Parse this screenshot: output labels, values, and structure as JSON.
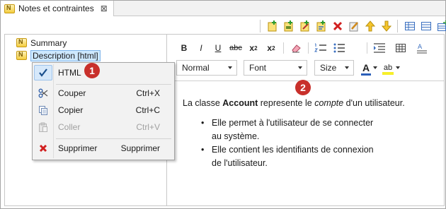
{
  "tab": {
    "title": "Notes et contraintes",
    "close": "⊠"
  },
  "tree": {
    "items": [
      {
        "label": "Summary",
        "selected": false
      },
      {
        "label": "Description [html]",
        "selected": true
      }
    ]
  },
  "context_menu": {
    "items": [
      {
        "label": "HTML",
        "shortcut": "",
        "checked": true,
        "enabled": true,
        "icon": "checkmark-icon"
      },
      {
        "label": "Couper",
        "shortcut": "Ctrl+X",
        "enabled": true,
        "icon": "scissors-icon"
      },
      {
        "label": "Copier",
        "shortcut": "Ctrl+C",
        "enabled": true,
        "icon": "copy-icon"
      },
      {
        "label": "Coller",
        "shortcut": "Ctrl+V",
        "enabled": false,
        "icon": "paste-icon"
      },
      {
        "label": "Supprimer",
        "shortcut": "Supprimer",
        "enabled": true,
        "icon": "delete-x-icon"
      }
    ]
  },
  "badges": {
    "one": "1",
    "two": "2"
  },
  "formatting": {
    "bold": "B",
    "italic": "I",
    "underline": "U",
    "strike": "abc",
    "subscript": "x",
    "subscript_mark": "2",
    "superscript": "x",
    "superscript_mark": "2"
  },
  "selects": {
    "style": "Normal",
    "font": "Font",
    "size": "Size",
    "text_color_glyph": "A",
    "highlight_glyph": "ab"
  },
  "content": {
    "p_before": "La classe ",
    "p_bold": "Account",
    "p_mid": " represente le ",
    "p_italic": "compte",
    "p_after": " d'un utilisateur.",
    "bullets": [
      {
        "line1": "Elle permet à l'utilisateur de se connecter",
        "line2": "au système."
      },
      {
        "line1": "Elle contient les identifiants de connexion",
        "line2": "de l'utilisateur."
      }
    ]
  },
  "colors": {
    "badge_red": "#c8302b",
    "selection_blue": "#cde8ff",
    "delete_red": "#d11f1f"
  }
}
